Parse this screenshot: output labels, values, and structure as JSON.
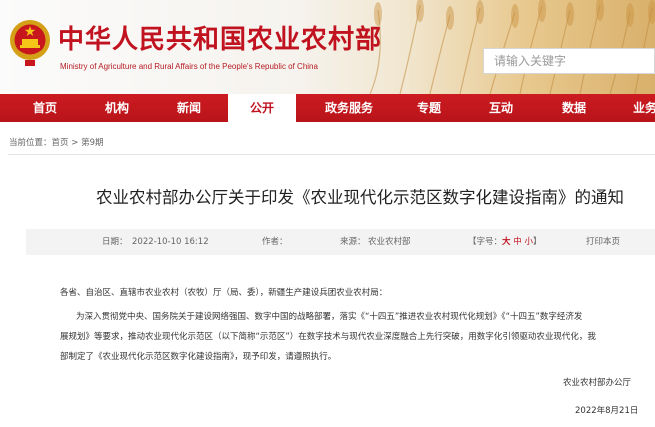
{
  "header": {
    "title": "中华人民共和国农业农村部",
    "subtitle": "Ministry of Agriculture and Rural Affairs of the People's Republic of China",
    "search_placeholder": "请输入关键字"
  },
  "nav": {
    "items": [
      {
        "label": "首页"
      },
      {
        "label": "机构"
      },
      {
        "label": "新闻"
      },
      {
        "label": "公开",
        "active": true
      },
      {
        "label": "政务服务"
      },
      {
        "label": "专题"
      },
      {
        "label": "互动"
      },
      {
        "label": "数据"
      },
      {
        "label": "业务"
      }
    ]
  },
  "breadcrumb": {
    "prefix": "当前位置：",
    "home": "首页",
    "sep": ">",
    "current": "第9期"
  },
  "article": {
    "title": "农业农村部办公厅关于印发《农业现代化示范区数字化建设指南》的通知",
    "meta": {
      "date_label": "日期：",
      "date_value": "2022-10-10 16:12",
      "author_label": "作者：",
      "source_label": "来源：",
      "source_value": "农业农村部",
      "font_open": "【字号：",
      "font_big": "大",
      "font_mid": "中",
      "font_small": "小",
      "font_close": "】",
      "print": "打印本页"
    },
    "salutation": "各省、自治区、直辖市农业农村（农牧）厅（局、委），新疆生产建设兵团农业农村局：",
    "paragraph_lines": [
      "为深入贯彻党中央、国务院关于建设网络强国、数字中国的战略部署，落实《“十四五”推进农业农村现代化规划》《“十四五”数字经济发",
      "展规划》等要求，推动农业现代化示范区（以下简称“示范区”）在数字技术与现代农业深度融合上先行突破，用数字化引领驱动农业现代化，我",
      "部制定了《农业现代化示范区数字化建设指南》，现予印发，请遵照执行。"
    ],
    "signature": "农业农村部办公厅",
    "sign_date": "2022年8月21日"
  },
  "colors": {
    "brand_red": "#c1121f",
    "nav_red": "#c21820"
  }
}
